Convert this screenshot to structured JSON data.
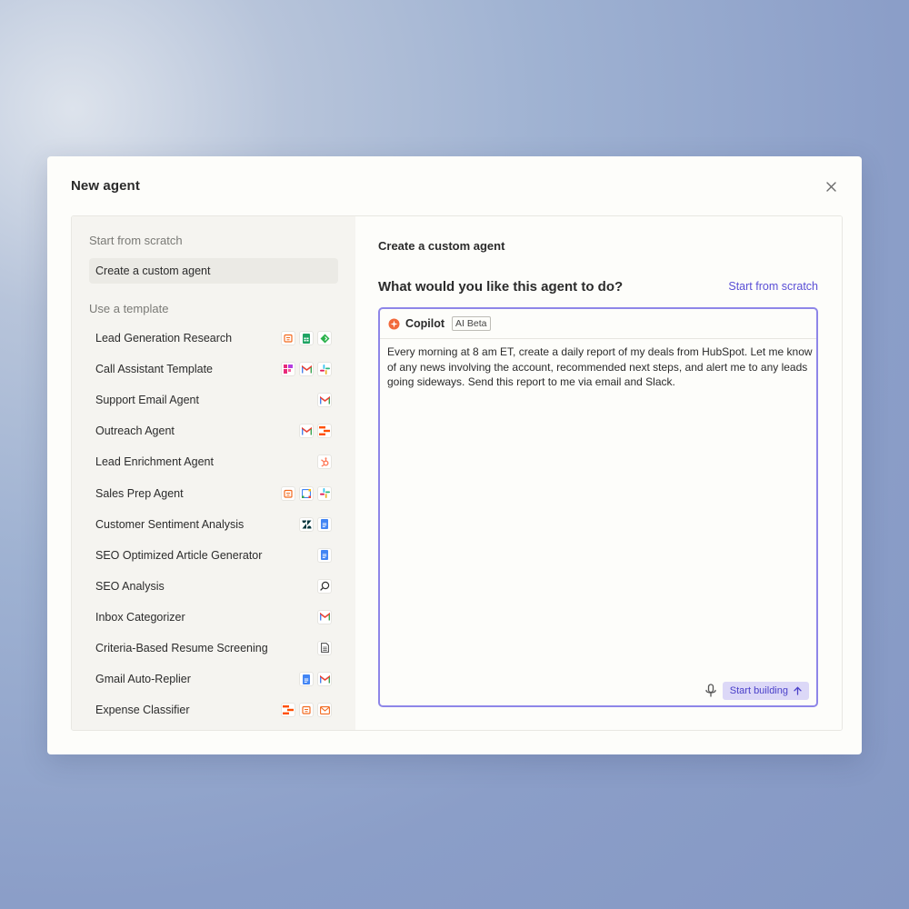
{
  "modal": {
    "title": "New agent"
  },
  "sidebar": {
    "scratch_label": "Start from scratch",
    "custom_item": "Create a custom agent",
    "template_label": "Use a template",
    "templates": [
      {
        "label": "Lead Generation Research",
        "icons": [
          "calendar-icon",
          "sheets-icon",
          "feedly-icon"
        ]
      },
      {
        "label": "Call Assistant Template",
        "icons": [
          "fireflies-icon",
          "gmail-icon",
          "slack-icon"
        ]
      },
      {
        "label": "Support Email Agent",
        "icons": [
          "gmail-icon"
        ]
      },
      {
        "label": "Outreach Agent",
        "icons": [
          "gmail-icon",
          "zapier-tables-icon"
        ]
      },
      {
        "label": "Lead Enrichment Agent",
        "icons": [
          "hubspot-icon"
        ]
      },
      {
        "label": "Sales Prep Agent",
        "icons": [
          "calendar-icon",
          "google-calendar-icon",
          "slack-icon"
        ]
      },
      {
        "label": "Customer Sentiment Analysis",
        "icons": [
          "zendesk-icon",
          "docs-icon"
        ]
      },
      {
        "label": "SEO Optimized Article Generator",
        "icons": [
          "docs-icon"
        ]
      },
      {
        "label": "SEO Analysis",
        "icons": [
          "search-icon"
        ]
      },
      {
        "label": "Inbox Categorizer",
        "icons": [
          "gmail-icon"
        ]
      },
      {
        "label": "Criteria-Based Resume Screening",
        "icons": [
          "document-icon"
        ]
      },
      {
        "label": "Gmail Auto-Replier",
        "icons": [
          "docs-icon",
          "gmail-icon"
        ]
      },
      {
        "label": "Expense Classifier",
        "icons": [
          "zapier-tables-icon",
          "calendar-icon",
          "email-icon"
        ]
      }
    ]
  },
  "main": {
    "title": "Create a custom agent",
    "question": "What would you like this agent to do?",
    "scratch_link": "Start from scratch",
    "copilot_label": "Copilot",
    "beta_badge": "AI Beta",
    "prompt": "Every morning at 8 am ET, create a daily report of my deals from HubSpot. Let me know of any news involving the account, recommended next steps, and alert me to any leads going sideways. Send this report to me via email and Slack.",
    "start_button": "Start building"
  },
  "colors": {
    "accent": "#5a4fd6",
    "composer_border": "#8e86e8",
    "button_bg": "#dcd8f7"
  }
}
